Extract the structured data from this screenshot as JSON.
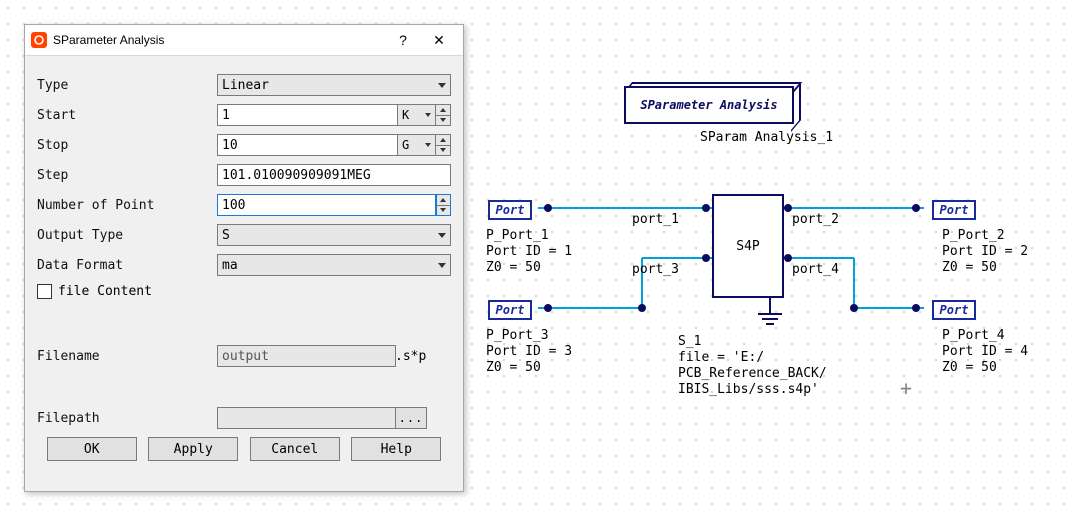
{
  "dialog": {
    "title": "SParameter Analysis",
    "type_label": "Type",
    "type_value": "Linear",
    "start_label": "Start",
    "start_value": "1",
    "start_unit": "K",
    "stop_label": "Stop",
    "stop_value": "10",
    "stop_unit": "G",
    "step_label": "Step",
    "step_value": "101.010090909091MEG",
    "npoints_label": "Number of Point",
    "npoints_value": "100",
    "out_type_label": "Output Type",
    "out_type_value": "S",
    "data_fmt_label": "Data Format",
    "data_fmt_value": "ma",
    "file_content_label": "file Content",
    "filename_label": "Filename",
    "filename_value": "output",
    "filename_suffix": ".s*p",
    "filepath_label": "Filepath",
    "filepath_value": "",
    "browse": "...",
    "ok": "OK",
    "apply": "Apply",
    "cancel": "Cancel",
    "help": "Help"
  },
  "schematic": {
    "analysis_box": "SParameter Analysis",
    "analysis_name": "SParam Analysis_1",
    "port_label": "Port",
    "port1": {
      "net": "port_1",
      "name": "P_Port_1",
      "id": "Port ID = 1",
      "z0": "Z0 = 50"
    },
    "port2": {
      "net": "port_2",
      "name": "P_Port_2",
      "id": "Port ID = 2",
      "z0": "Z0 = 50"
    },
    "port3": {
      "net": "port_3",
      "name": "P_Port_3",
      "id": "Port ID = 3",
      "z0": "Z0 = 50"
    },
    "port4": {
      "net": "port_4",
      "name": "P_Port_4",
      "id": "Port ID = 4",
      "z0": "Z0 = 50"
    },
    "s4p_label": "S4P",
    "s4p_name": "S_1",
    "s4p_file": "file = 'E:/\nPCB_Reference_BACK/\nIBIS_Libs/sss.s4p'"
  }
}
